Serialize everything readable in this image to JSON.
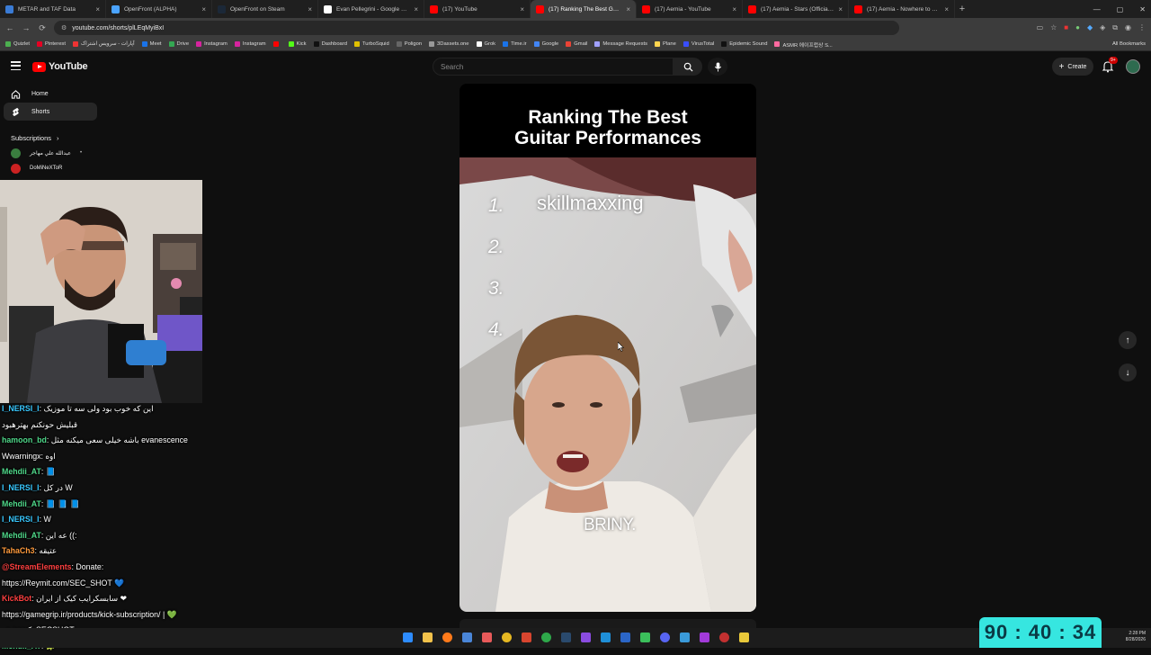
{
  "browser": {
    "tabs": [
      {
        "label": "METAR and TAF Data",
        "color": "#3a7bd5"
      },
      {
        "label": "OpenFront (ALPHA)",
        "color": "#4aa3ff"
      },
      {
        "label": "OpenFront on Steam",
        "color": "#1b2838"
      },
      {
        "label": "Evan Pellegrini - Google Search",
        "color": "#ffffff"
      },
      {
        "label": "(17) YouTube",
        "color": "#ff0000"
      },
      {
        "label": "(17) Ranking The Best Guita",
        "color": "#ff0000",
        "active": true
      },
      {
        "label": "(17) Aemia - YouTube",
        "color": "#ff0000"
      },
      {
        "label": "(17) Aemia - Stars (Official Mu",
        "color": "#ff0000"
      },
      {
        "label": "(17) Aemia - Nowhere to Hide",
        "color": "#ff0000"
      }
    ],
    "url": "youtube.com/shorts/plLEqMyiBxI",
    "bookmarks": [
      "Quizlet",
      "Pinterest",
      "آپارات - سرویس اشتراک",
      "Meet",
      "Drive",
      "Instagram",
      "Instagram",
      "",
      "Kick",
      "Dashboard",
      "TurboSquid",
      "Poligon",
      "3Dassets.one",
      "Grok",
      "Time.ir",
      "Google",
      "Gmail",
      "Message Requests",
      "Plane",
      "VirusTotal",
      "Epidemic Sound",
      "ASMR 에이프럽상 S..."
    ],
    "all_bookmarks": "All Bookmarks"
  },
  "youtube": {
    "logo_text": "YouTube",
    "search_placeholder": "Search",
    "create_label": "Create",
    "notif_badge": "9+",
    "sidebar": {
      "home": "Home",
      "shorts": "Shorts",
      "subscriptions": "Subscriptions",
      "sub_items": [
        "عبدالله علي مهاجر",
        "DoMiNeXToR"
      ]
    },
    "short": {
      "title_line1": "Ranking The Best",
      "title_line2": "Guitar Performances",
      "ranks": [
        "1.",
        "2.",
        "3.",
        "4."
      ],
      "rank1_text": "skillmaxxing",
      "caption": "BRINY."
    }
  },
  "chat": [
    {
      "user": "I_NERSI_I",
      "msg": "این که خوب بود ولی سه تا موزیک",
      "cls": "name-c"
    },
    {
      "user": "",
      "msg": "قبلیش حونکنم بهترهبود",
      "cls": ""
    },
    {
      "user": "hamoon_bd",
      "msg": "باشه خیلی سعی میکنه مثل evanescence",
      "cls": "name-g"
    },
    {
      "user": "Wwarningx",
      "msg": "اوه",
      "cls": ""
    },
    {
      "user": "Mehdii_AT",
      "msg": "📘",
      "cls": "name-g"
    },
    {
      "user": "I_NERSI_I",
      "msg": "در کل W",
      "cls": "name-c"
    },
    {
      "user": "Mehdii_AT",
      "msg": "📘 📘 📘",
      "cls": "name-g"
    },
    {
      "user": "I_NERSI_I",
      "msg": "W",
      "cls": "name-c"
    },
    {
      "user": "Mehdii_AT",
      "msg": "عه این ((:",
      "cls": "name-g"
    },
    {
      "user": "TahaCh3",
      "msg": "عتیقه",
      "cls": "name-o"
    },
    {
      "user": "@StreamElements",
      "msg": "Donate:",
      "cls": "name-r"
    },
    {
      "user": "",
      "msg": "https://Reymit.com/SEC_SHOT 💙",
      "cls": ""
    },
    {
      "user": "KickBot",
      "msg": "سابسکرایب کیک از ایران ❤",
      "cls": "name-r"
    },
    {
      "user": "",
      "msg": "https://gamegrip.ir/products/kick-subscription/ | 💚",
      "cls": ""
    },
    {
      "user": "",
      "msg": "کدتخفیف: SECSHOT",
      "cls": ""
    },
    {
      "user": "Mehdii_AT",
      "msg": "🐢",
      "cls": "name-g"
    }
  ],
  "timer": "90 : 40 : 34",
  "clock": {
    "time": "2:28 PM",
    "date": "8/28/2026"
  }
}
